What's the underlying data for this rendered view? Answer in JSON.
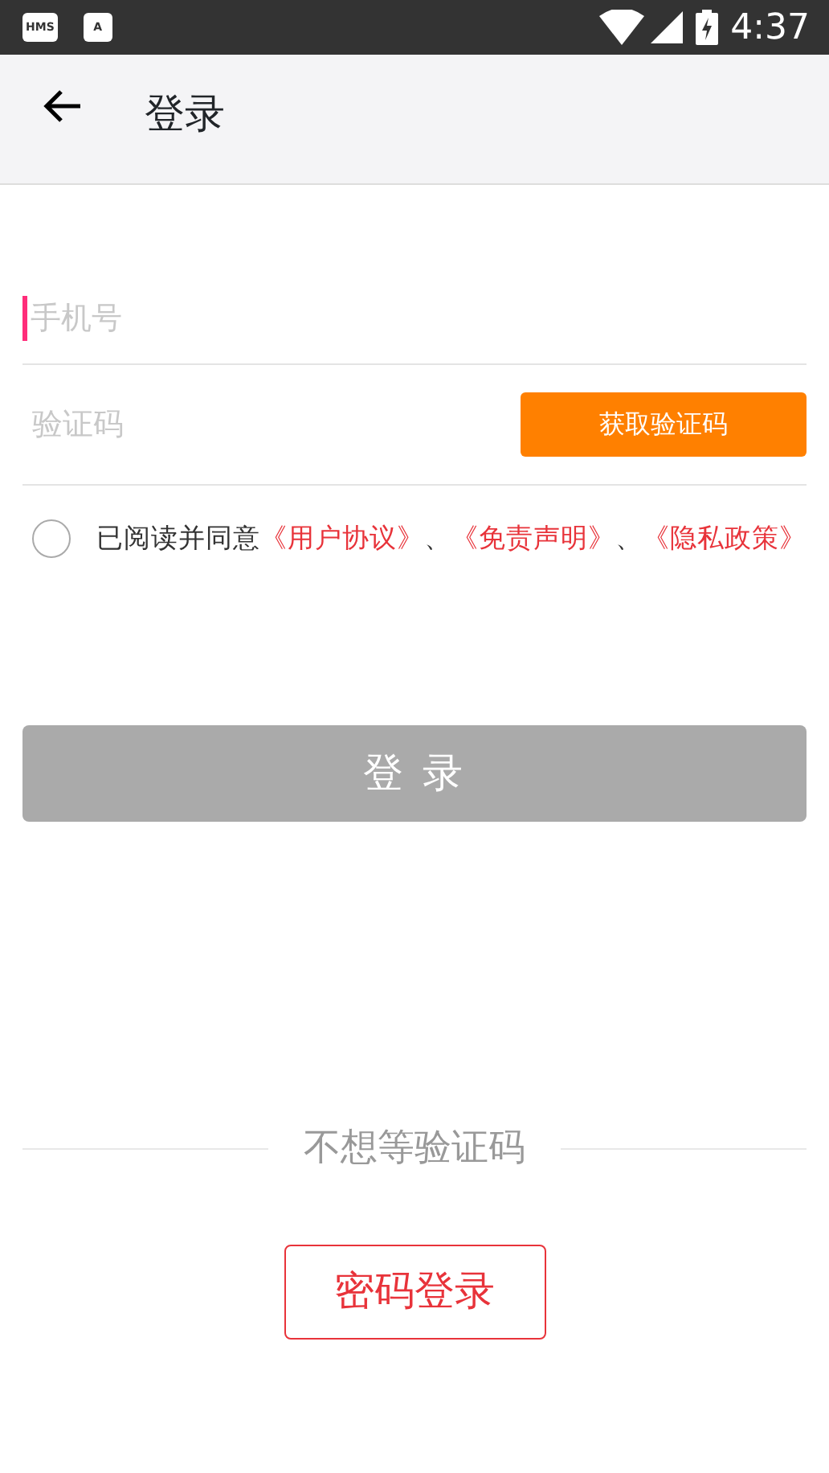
{
  "status_bar": {
    "apps": [
      "HMS",
      "A"
    ],
    "time": "4:37"
  },
  "toolbar": {
    "title": "登录"
  },
  "phone_field": {
    "placeholder": "手机号",
    "focused": true
  },
  "code_field": {
    "placeholder": "验证码"
  },
  "get_code_button": {
    "label": "获取验证码"
  },
  "agreement": {
    "checked": false,
    "parts": [
      {
        "kind": "text",
        "text": "已阅读并同意"
      },
      {
        "kind": "link",
        "text": "《用户协议》"
      },
      {
        "kind": "text",
        "text": "、"
      },
      {
        "kind": "link",
        "text": "《免责声明》"
      },
      {
        "kind": "text",
        "text": "、"
      },
      {
        "kind": "link",
        "text": "《隐私政策》"
      }
    ]
  },
  "login_button": {
    "label": "登 录",
    "disabled": true
  },
  "divider_text": "不想等验证码",
  "password_login_button": {
    "label": "密码登录"
  }
}
